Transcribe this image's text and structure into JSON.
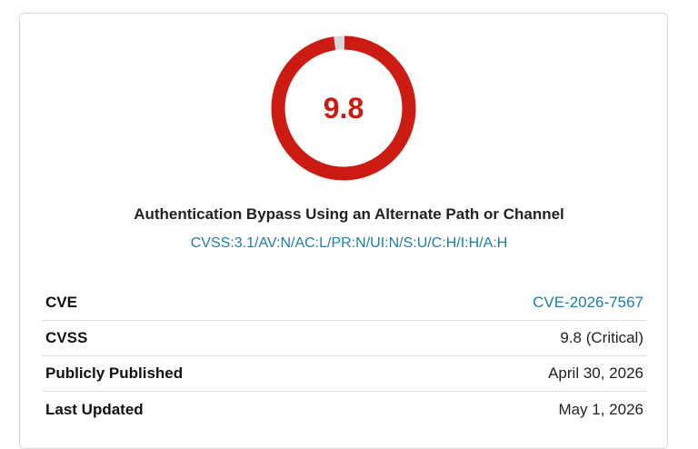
{
  "score": {
    "value": "9.8",
    "fraction": 0.98,
    "color": "#cc1b12",
    "track_color": "#d9d9d9"
  },
  "weakness_title": "Authentication Bypass Using an Alternate Path or Channel",
  "cvss_vector": "CVSS:3.1/AV:N/AC:L/PR:N/UI:N/S:U/C:H/I:H/A:H",
  "details": [
    {
      "label": "CVE",
      "value": "CVE-2026-7567",
      "link": true
    },
    {
      "label": "CVSS",
      "value": "9.8 (Critical)",
      "link": false
    },
    {
      "label": "Publicly Published",
      "value": "April 30, 2026",
      "link": false
    },
    {
      "label": "Last Updated",
      "value": "May 1, 2026",
      "link": false
    }
  ]
}
